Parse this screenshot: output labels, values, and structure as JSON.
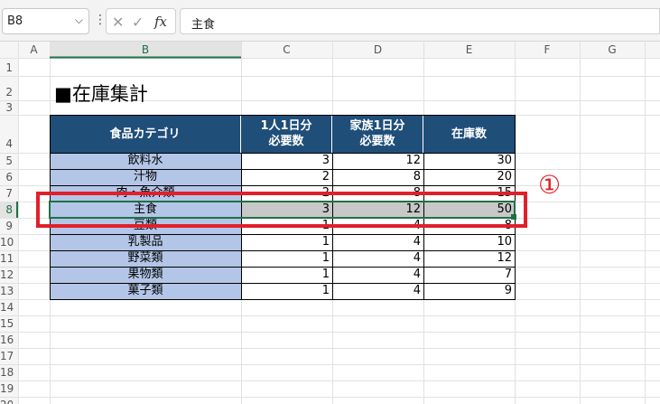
{
  "formula_bar": {
    "name_box": "B8",
    "name_box_dropdown_glyph": "⌵",
    "menu_glyph": "⋮",
    "cancel_glyph": "✕",
    "enter_glyph": "✓",
    "fx_glyph": "fx",
    "formula_value": "主食"
  },
  "columns": [
    "A",
    "B",
    "C",
    "D",
    "E",
    "F",
    "G"
  ],
  "rows": [
    "1",
    "2",
    "3",
    "4",
    "5",
    "6",
    "7",
    "8",
    "9",
    "10",
    "11",
    "12",
    "13",
    "14",
    "15",
    "16",
    "17",
    "18",
    "19",
    "20"
  ],
  "sheet": {
    "title": "■在庫集計",
    "headers": [
      "食品カテゴリ",
      "1人1日分",
      "必要数",
      "家族1日分",
      "必要数",
      "在庫数"
    ],
    "table": [
      {
        "name": "飲料水",
        "per_person": "3",
        "family": "12",
        "stock": "30"
      },
      {
        "name": "汁物",
        "per_person": "2",
        "family": "8",
        "stock": "20"
      },
      {
        "name": "肉・魚介類",
        "per_person": "2",
        "family": "8",
        "stock": "15"
      },
      {
        "name": "主食",
        "per_person": "3",
        "family": "12",
        "stock": "50"
      },
      {
        "name": "豆類",
        "per_person": "1",
        "family": "4",
        "stock": "8"
      },
      {
        "name": "乳製品",
        "per_person": "1",
        "family": "4",
        "stock": "10"
      },
      {
        "name": "野菜類",
        "per_person": "1",
        "family": "4",
        "stock": "12"
      },
      {
        "name": "果物類",
        "per_person": "1",
        "family": "4",
        "stock": "7"
      },
      {
        "name": "菓子類",
        "per_person": "1",
        "family": "4",
        "stock": "9"
      }
    ]
  },
  "annotation": {
    "label": "①",
    "color": "#e0202a"
  },
  "colors": {
    "header_fill": "#1f4e79",
    "category_fill": "#b4c6e7",
    "selected_row_fill": "#c8c8c8",
    "excel_green": "#1e7145"
  }
}
